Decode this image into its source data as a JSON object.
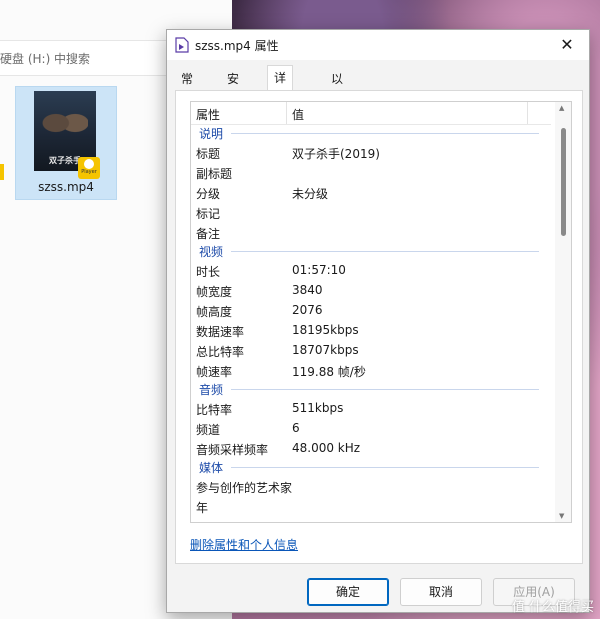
{
  "explorer": {
    "search_placeholder": "硬盘 (H:) 中搜索",
    "file": {
      "name": "szss.mp4",
      "poster_title": "双子杀手",
      "badge": "Player"
    }
  },
  "dialog": {
    "title": "szss.mp4 属性",
    "tabs": [
      "常规",
      "安全",
      "详细信息",
      "以前的版本"
    ],
    "active_tab": "详细信息",
    "columns": {
      "property": "属性",
      "value": "值"
    },
    "groups": [
      {
        "name": "说明",
        "rows": [
          {
            "k": "标题",
            "v": "双子杀手(2019)"
          },
          {
            "k": "副标题",
            "v": ""
          },
          {
            "k": "分级",
            "v": "未分级"
          },
          {
            "k": "标记",
            "v": ""
          },
          {
            "k": "备注",
            "v": ""
          }
        ]
      },
      {
        "name": "视频",
        "rows": [
          {
            "k": "时长",
            "v": "01:57:10"
          },
          {
            "k": "帧宽度",
            "v": "3840"
          },
          {
            "k": "帧高度",
            "v": "2076"
          },
          {
            "k": "数据速率",
            "v": "18195kbps"
          },
          {
            "k": "总比特率",
            "v": "18707kbps"
          },
          {
            "k": "帧速率",
            "v": "119.88 帧/秒"
          }
        ]
      },
      {
        "name": "音频",
        "rows": [
          {
            "k": "比特率",
            "v": "511kbps"
          },
          {
            "k": "频道",
            "v": "6"
          },
          {
            "k": "音频采样频率",
            "v": "48.000 kHz"
          }
        ]
      },
      {
        "name": "媒体",
        "rows": [
          {
            "k": "参与创作的艺术家",
            "v": ""
          },
          {
            "k": "年",
            "v": ""
          }
        ]
      }
    ],
    "remove_link": "删除属性和个人信息",
    "buttons": {
      "ok": "确定",
      "cancel": "取消",
      "apply": "应用(A)"
    }
  },
  "watermark": "值 什么值得买",
  "colors": {
    "accent": "#0067c0",
    "group_header": "#1c4aa8",
    "link": "#0a56b8"
  }
}
